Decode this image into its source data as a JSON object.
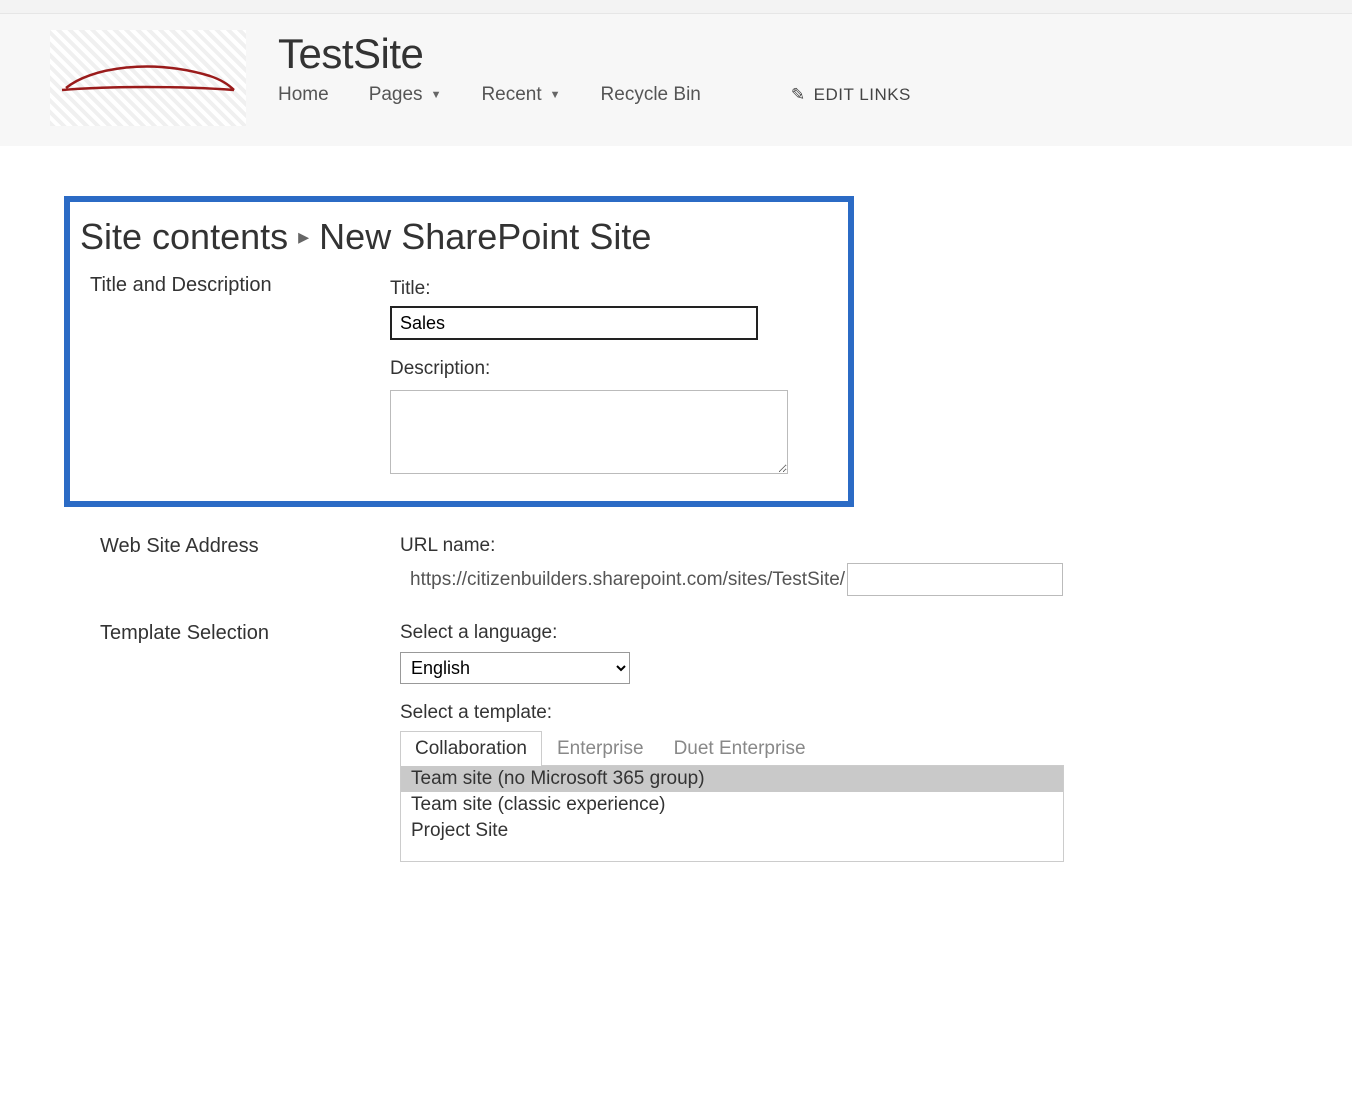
{
  "header": {
    "site_title": "TestSite",
    "nav": {
      "home": "Home",
      "pages": "Pages",
      "recent": "Recent",
      "recycle": "Recycle Bin",
      "edit_links": "EDIT LINKS"
    }
  },
  "breadcrumb": {
    "part1": "Site contents",
    "part2": "New SharePoint Site"
  },
  "sections": {
    "title_desc": {
      "heading": "Title and Description",
      "title_label": "Title:",
      "title_value": "Sales",
      "desc_label": "Description:",
      "desc_value": ""
    },
    "address": {
      "heading": "Web Site Address",
      "url_label": "URL name:",
      "url_prefix": "https://citizenbuilders.sharepoint.com/sites/TestSite/",
      "url_value": ""
    },
    "template": {
      "heading": "Template Selection",
      "lang_label": "Select a language:",
      "lang_value": "English",
      "template_label": "Select a template:",
      "tabs": {
        "collab": "Collaboration",
        "enterprise": "Enterprise",
        "duet": "Duet Enterprise"
      },
      "items": {
        "t0": "Team site (no Microsoft 365 group)",
        "t1": "Team site (classic experience)",
        "t2": "Project Site"
      }
    }
  }
}
